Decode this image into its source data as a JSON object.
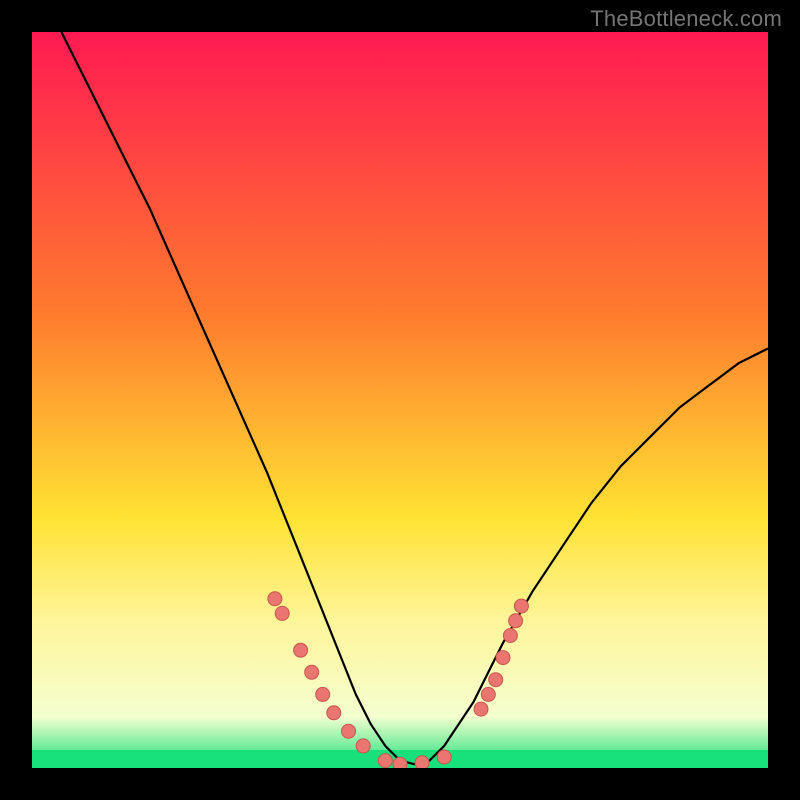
{
  "watermark": "TheBottleneck.com",
  "colors": {
    "grad_top": "#ff1a52",
    "grad_mid1": "#ff7a2e",
    "grad_mid2": "#ffe233",
    "grad_low": "#fff59a",
    "grad_bottom_band": "#f4ffcf",
    "grad_green": "#18e07a",
    "curve": "#000000",
    "dot_fill": "#e9776f",
    "dot_stroke": "#c9554e"
  },
  "chart_data": {
    "type": "line",
    "title": "",
    "xlabel": "",
    "ylabel": "",
    "xlim": [
      0,
      100
    ],
    "ylim": [
      0,
      100
    ],
    "series": [
      {
        "name": "bottleneck-curve",
        "x": [
          4,
          8,
          12,
          16,
          20,
          24,
          28,
          32,
          34,
          36,
          38,
          40,
          42,
          44,
          46,
          48,
          50,
          52,
          54,
          56,
          60,
          62,
          64,
          68,
          72,
          76,
          80,
          84,
          88,
          92,
          96,
          100
        ],
        "y": [
          100,
          92,
          84,
          76,
          67,
          58,
          49,
          40,
          35,
          30,
          25,
          20,
          15,
          10,
          6,
          3,
          1,
          0.5,
          1,
          3,
          9,
          13,
          17,
          24,
          30,
          36,
          41,
          45,
          49,
          52,
          55,
          57
        ]
      }
    ],
    "points": [
      {
        "x": 33,
        "y": 23
      },
      {
        "x": 34,
        "y": 21
      },
      {
        "x": 36.5,
        "y": 16
      },
      {
        "x": 38,
        "y": 13
      },
      {
        "x": 39.5,
        "y": 10
      },
      {
        "x": 41,
        "y": 7.5
      },
      {
        "x": 43,
        "y": 5
      },
      {
        "x": 45,
        "y": 3
      },
      {
        "x": 48,
        "y": 1
      },
      {
        "x": 50,
        "y": 0.5
      },
      {
        "x": 53,
        "y": 0.7
      },
      {
        "x": 56,
        "y": 1.5
      },
      {
        "x": 61,
        "y": 8
      },
      {
        "x": 62,
        "y": 10
      },
      {
        "x": 63,
        "y": 12
      },
      {
        "x": 64,
        "y": 15
      },
      {
        "x": 65,
        "y": 18
      },
      {
        "x": 65.7,
        "y": 20
      },
      {
        "x": 66.5,
        "y": 22
      }
    ]
  }
}
